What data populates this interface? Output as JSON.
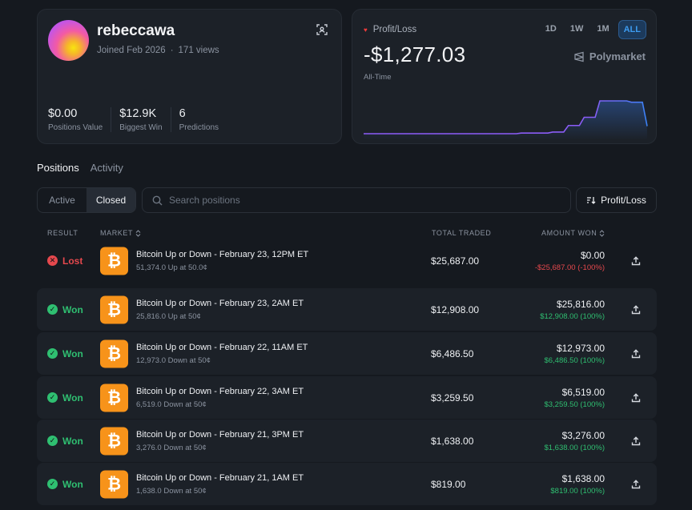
{
  "profile": {
    "username": "rebeccawa",
    "joined": "Joined Feb 2026",
    "views": "171 views",
    "stats": [
      {
        "value": "$0.00",
        "label": "Positions Value"
      },
      {
        "value": "$12.9K",
        "label": "Biggest Win"
      },
      {
        "value": "6",
        "label": "Predictions"
      }
    ]
  },
  "pnl": {
    "label": "Profit/Loss",
    "value": "-$1,277.03",
    "period": "All-Time",
    "ranges": [
      "1D",
      "1W",
      "1M",
      "ALL"
    ],
    "active_range": "ALL",
    "brand": "Polymarket",
    "line_color": "#8b5cf6",
    "line_color_end": "#3b82f6",
    "series": [
      0,
      0,
      0,
      0,
      0,
      0,
      0,
      0,
      0,
      0,
      0.2,
      0.2,
      0.5,
      2.5,
      5,
      10,
      10,
      9.6,
      2.3
    ]
  },
  "tabs": {
    "positions": "Positions",
    "activity": "Activity"
  },
  "filters": {
    "active": "Active",
    "closed": "Closed",
    "search_placeholder": "Search positions",
    "sort_label": "Profit/Loss"
  },
  "table": {
    "headers": {
      "result": "RESULT",
      "market": "MARKET",
      "total": "TOTAL TRADED",
      "amount": "AMOUNT WON"
    },
    "rows": [
      {
        "result": "Lost",
        "title": "Bitcoin Up or Down - February 23, 12PM ET",
        "sub": "51,374.0 Up at 50.0¢",
        "traded": "$25,687.00",
        "won": "$0.00",
        "pct": "-$25,687.00 (-100%)"
      },
      {
        "result": "Won",
        "title": "Bitcoin Up or Down - February 23, 2AM ET",
        "sub": "25,816.0 Up at 50¢",
        "traded": "$12,908.00",
        "won": "$25,816.00",
        "pct": "$12,908.00 (100%)"
      },
      {
        "result": "Won",
        "title": "Bitcoin Up or Down - February 22, 11AM ET",
        "sub": "12,973.0 Down at 50¢",
        "traded": "$6,486.50",
        "won": "$12,973.00",
        "pct": "$6,486.50 (100%)"
      },
      {
        "result": "Won",
        "title": "Bitcoin Up or Down - February 22, 3AM ET",
        "sub": "6,519.0 Down at 50¢",
        "traded": "$3,259.50",
        "won": "$6,519.00",
        "pct": "$3,259.50 (100%)"
      },
      {
        "result": "Won",
        "title": "Bitcoin Up or Down - February 21, 3PM ET",
        "sub": "3,276.0 Down at 50¢",
        "traded": "$1,638.00",
        "won": "$3,276.00",
        "pct": "$1,638.00 (100%)"
      },
      {
        "result": "Won",
        "title": "Bitcoin Up or Down - February 21, 1AM ET",
        "sub": "1,638.0 Down at 50¢",
        "traded": "$819.00",
        "won": "$1,638.00",
        "pct": "$819.00 (100%)"
      }
    ]
  }
}
